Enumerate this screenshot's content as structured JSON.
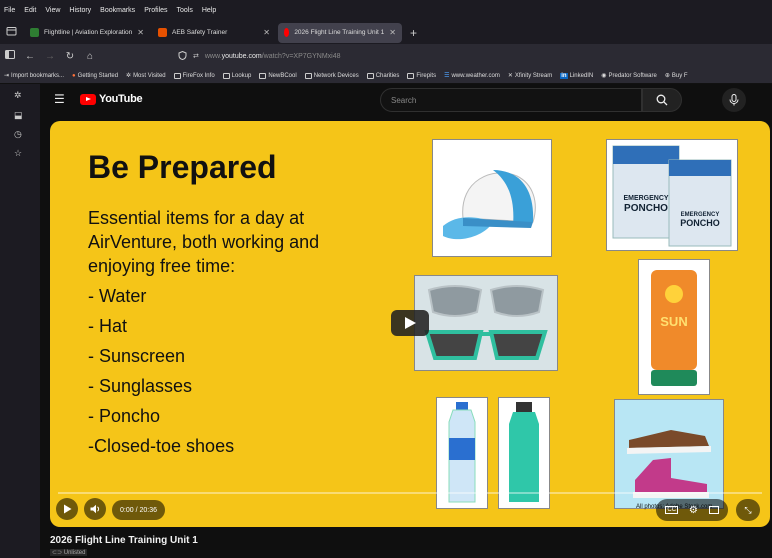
{
  "browser": {
    "menu": [
      "File",
      "Edit",
      "View",
      "History",
      "Bookmarks",
      "Profiles",
      "Tools",
      "Help"
    ],
    "tabs": [
      {
        "label": "Flightline | Aviation Exploration",
        "favicon_color": "#4caf50",
        "active": false
      },
      {
        "label": "AEB Safety Trainer",
        "favicon_color": "#e65100",
        "active": false
      },
      {
        "label": "2026 Flight Line Training Unit 1",
        "favicon_color": "#ff0000",
        "active": true
      }
    ],
    "url": {
      "prefix": "www.",
      "host": "youtube.com",
      "path": "/watch?v=XP7GYNMxi48"
    },
    "bookmarks": [
      "Import bookmarks...",
      "Getting Started",
      "Most Visited",
      "FireFox Info",
      "Lookup",
      "NewBCool",
      "Network Devices",
      "Charities",
      "Firepits",
      "www.weather.com",
      "Xfinity Stream",
      "LinkedIN",
      "Predator Software",
      "Buy F"
    ]
  },
  "youtube": {
    "logo_text": "YouTube",
    "search_placeholder": "Search"
  },
  "slide": {
    "title": "Be Prepared",
    "intro": "Essential items for a day at AirVenture, both working and enjoying free time:",
    "items": [
      "- Water",
      "- Hat",
      "- Sunscreen",
      "- Sunglasses",
      "- Poncho",
      "-Closed-toe shoes"
    ],
    "poncho_label": "EMERGENCY PONCHO",
    "sun_label": "SUN",
    "photo_credit": "All photos: Adobe Stock.com"
  },
  "player": {
    "time": "0:00 / 20:36",
    "progress": 0
  },
  "video": {
    "title": "2026 Flight Line Training Unit 1",
    "badge": "Unlisted"
  },
  "colors": {
    "slide_bg": "#f5c518",
    "yt_red": "#ff0000"
  }
}
